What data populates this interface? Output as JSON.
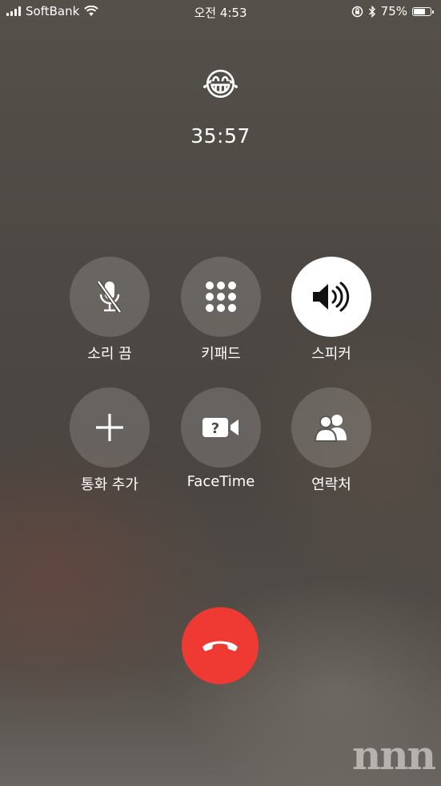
{
  "status_bar": {
    "carrier": "SoftBank",
    "time": "오전 4:53",
    "battery_percent": "75%",
    "battery_level": 0.75,
    "icons": [
      "signal-icon",
      "wifi-icon",
      "rotation-lock-icon",
      "bluetooth-icon",
      "battery-icon"
    ]
  },
  "caller": {
    "emoji": "😂",
    "call_duration": "35:57"
  },
  "controls": {
    "mute": {
      "label": "소리 끔",
      "icon": "mic-muted-icon"
    },
    "keypad": {
      "label": "키패드",
      "icon": "keypad-icon"
    },
    "speaker": {
      "label": "스피커",
      "icon": "speaker-icon",
      "active": true
    },
    "add_call": {
      "label": "통화 추가",
      "icon": "plus-icon"
    },
    "facetime": {
      "label": "FaceTime",
      "icon": "facetime-unavailable-icon"
    },
    "contacts": {
      "label": "연락처",
      "icon": "contacts-icon"
    }
  },
  "end_call": {
    "icon": "hangup-icon",
    "color": "#ee3a33"
  },
  "watermark": {
    "text": "nnn"
  }
}
